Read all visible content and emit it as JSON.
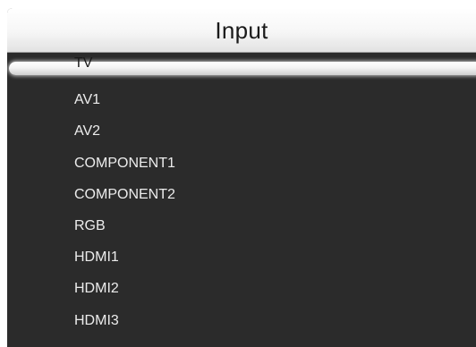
{
  "menu": {
    "title": "Input",
    "selected_index": 0,
    "items": [
      {
        "label": "TV"
      },
      {
        "label": "AV1"
      },
      {
        "label": "AV2"
      },
      {
        "label": "COMPONENT1"
      },
      {
        "label": "COMPONENT2"
      },
      {
        "label": "RGB"
      },
      {
        "label": "HDMI1"
      },
      {
        "label": "HDMI2"
      },
      {
        "label": "HDMI3"
      }
    ]
  },
  "colors": {
    "panel_background": "#2b2b2b",
    "header_background": "#f4f4f4",
    "item_text": "#ececec",
    "selected_text": "#1a1a1a",
    "highlight": "#f4f4f4"
  }
}
